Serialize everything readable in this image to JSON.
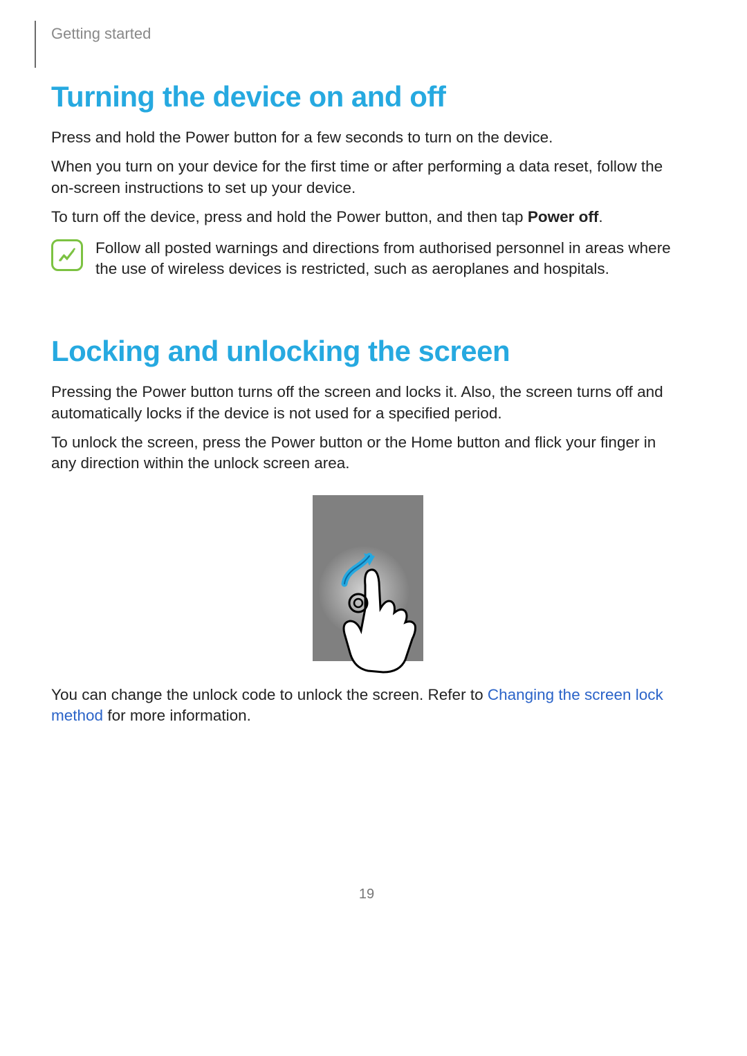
{
  "breadcrumb": "Getting started",
  "section1": {
    "heading": "Turning the device on and off",
    "p1": "Press and hold the Power button for a few seconds to turn on the device.",
    "p2": "When you turn on your device for the first time or after performing a data reset, follow the on-screen instructions to set up your device.",
    "p3_pre": "To turn off the device, press and hold the Power button, and then tap ",
    "p3_bold": "Power off",
    "p3_post": ".",
    "note": "Follow all posted warnings and directions from authorised personnel in areas where the use of wireless devices is restricted, such as aeroplanes and hospitals."
  },
  "section2": {
    "heading": "Locking and unlocking the screen",
    "p1": "Pressing the Power button turns off the screen and locks it. Also, the screen turns off and automatically locks if the device is not used for a specified period.",
    "p2": "To unlock the screen, press the Power button or the Home button and flick your finger in any direction within the unlock screen area.",
    "p3_pre": "You can change the unlock code to unlock the screen. Refer to ",
    "p3_link": "Changing the screen lock method",
    "p3_post": " for more information."
  },
  "page_number": "19"
}
